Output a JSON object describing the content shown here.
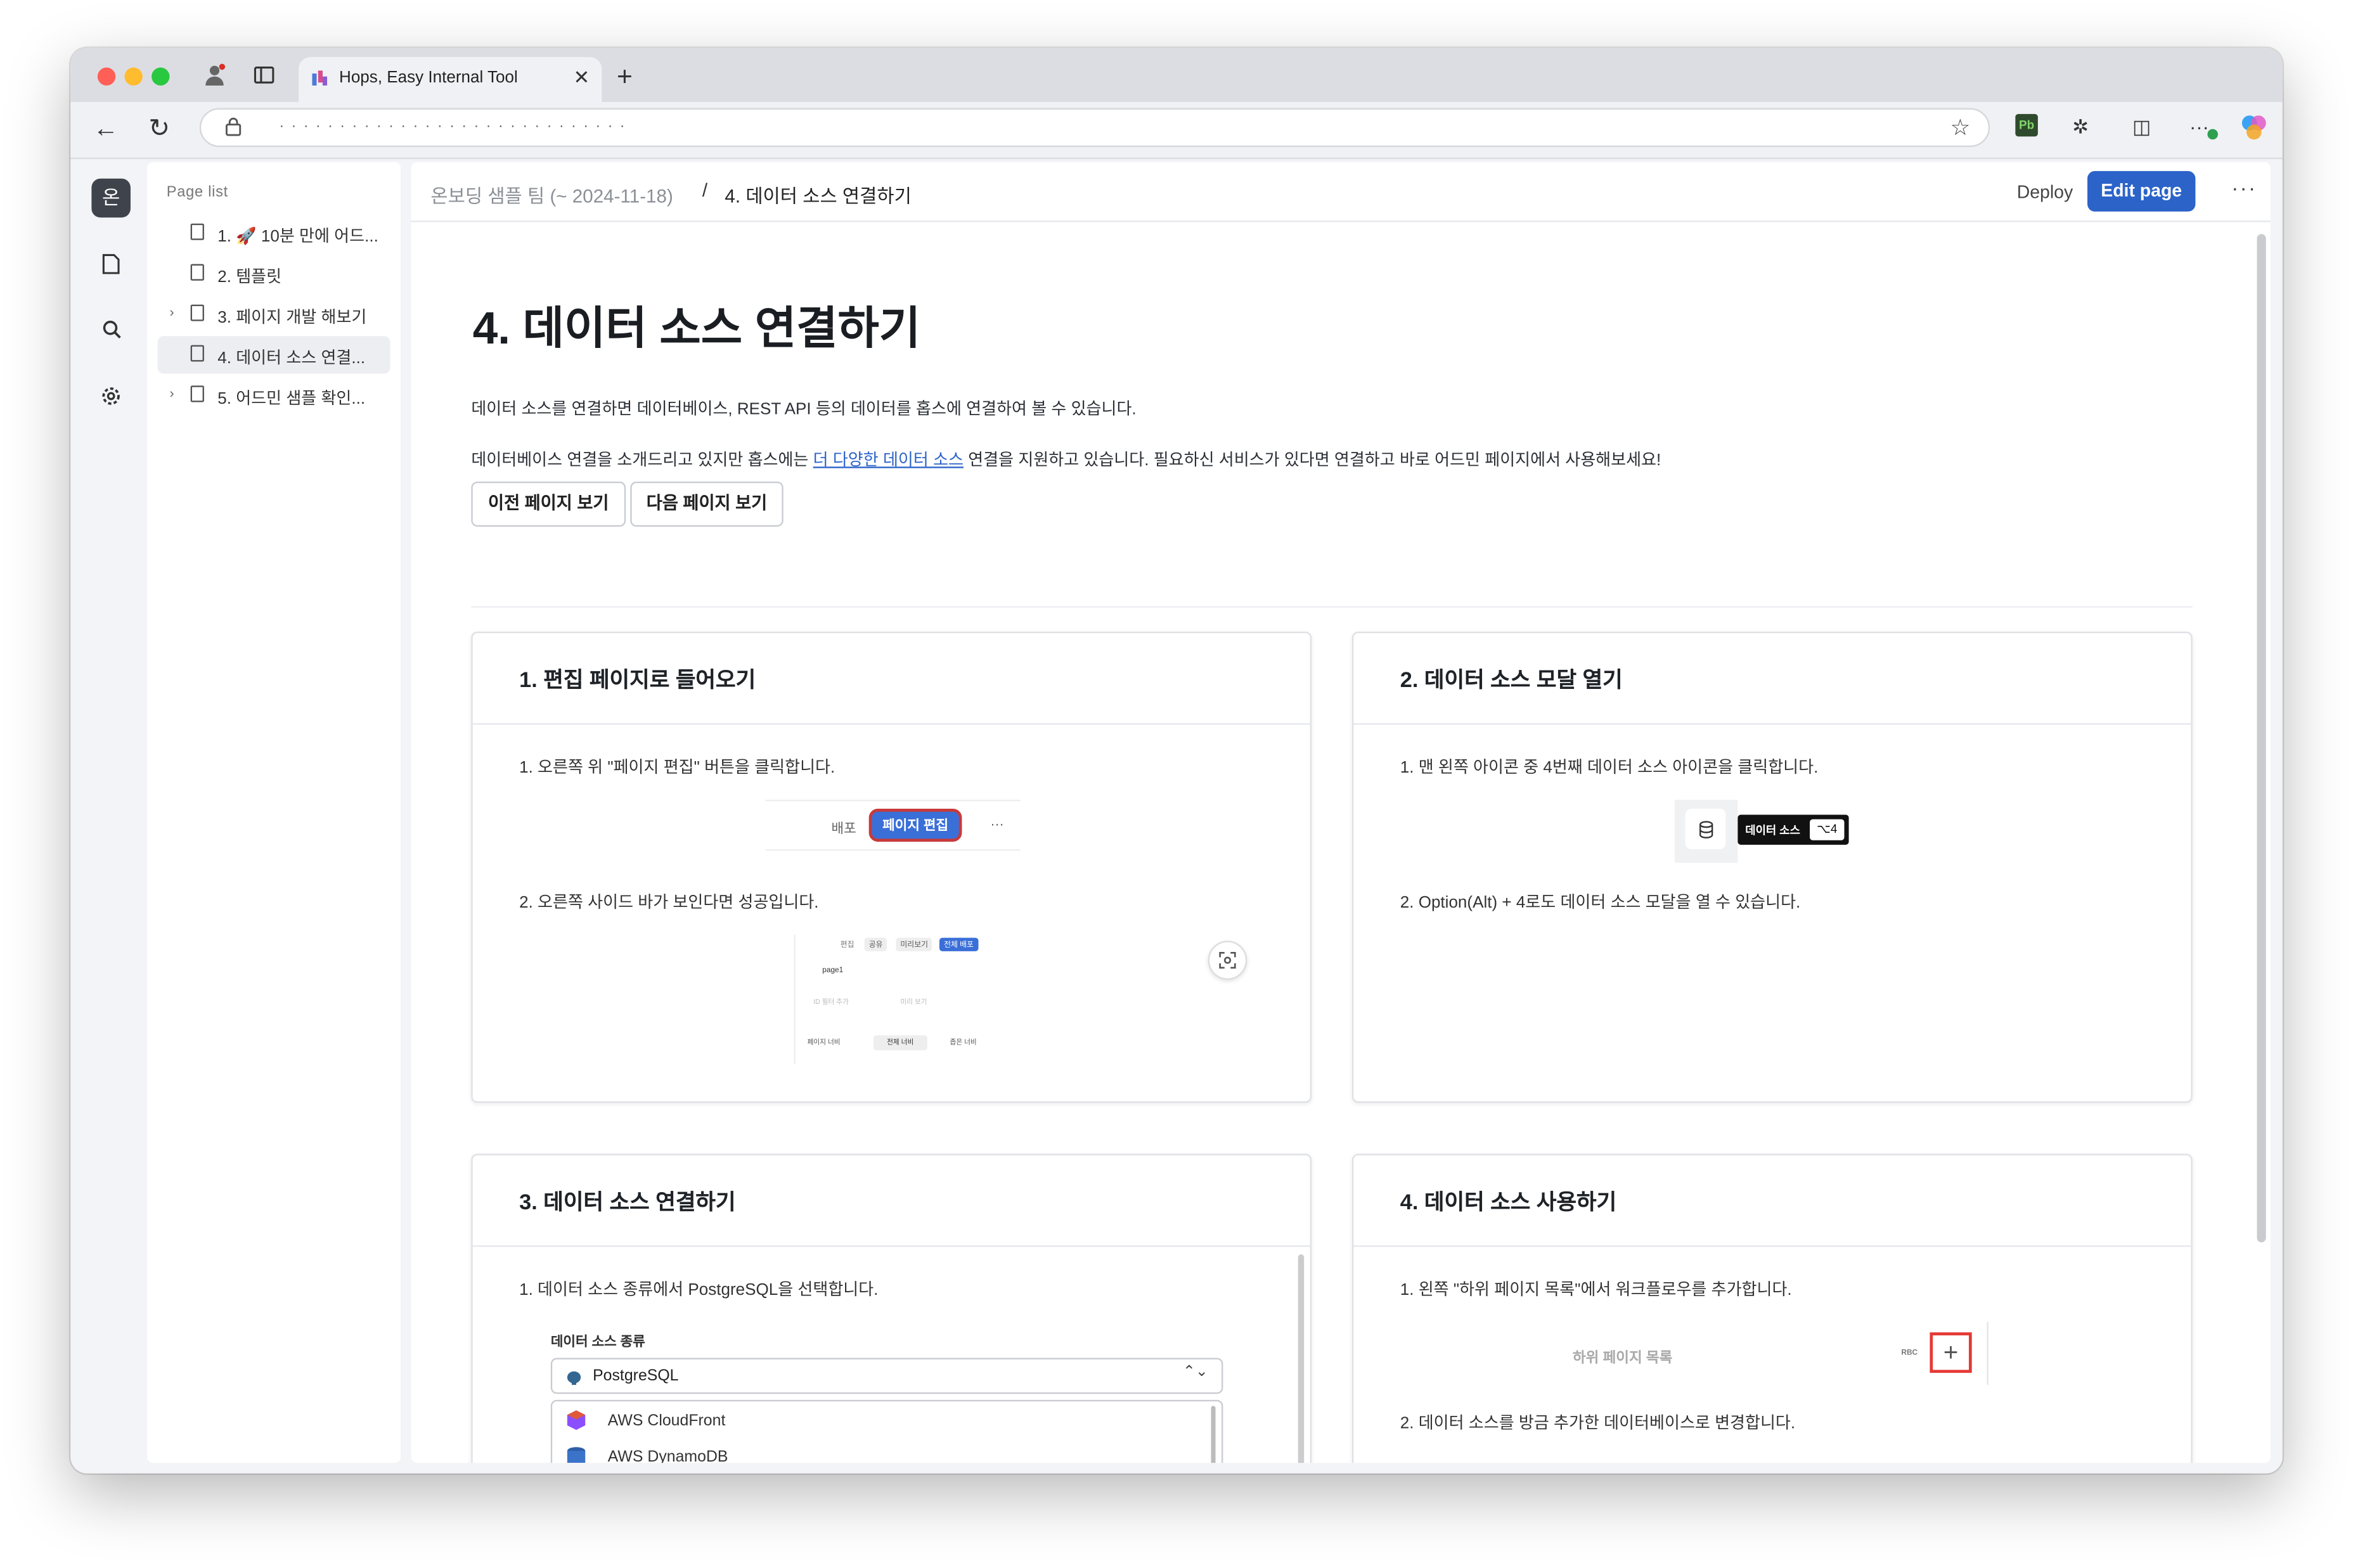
{
  "browser": {
    "tab_title": "Hops, Easy Internal Tool",
    "new_tab_label": "+",
    "url_text": "·  ·  ·  ·  ·  ·  ·  ·  ·  ·  ·  ·  ·  ·  ·  ·  ·  ·  ·  ·  ·  ·  ·  ·  ·  ·  ·  ·  ·",
    "extension_label": "Pb"
  },
  "rail": {
    "avatar_label": "온"
  },
  "page_list": {
    "title": "Page list",
    "items": [
      {
        "label": "1. 🚀 10분 만에 어드...",
        "has_children": false
      },
      {
        "label": "2. 템플릿",
        "has_children": false
      },
      {
        "label": "3. 페이지 개발 해보기",
        "has_children": true
      },
      {
        "label": "4. 데이터 소스 연결...",
        "has_children": false
      },
      {
        "label": "5. 어드민 샘플 확인...",
        "has_children": true
      }
    ]
  },
  "header": {
    "team": "온보딩 샘플 팀 (~ 2024-11-18)",
    "separator": "/",
    "page": "4. 데이터 소스 연결하기",
    "deploy_label": "Deploy",
    "edit_label": "Edit page",
    "more_label": "···"
  },
  "content": {
    "title": "4. 데이터 소스 연결하기",
    "para1": "데이터 소스를 연결하면 데이터베이스, REST API 등의 데이터를 홉스에 연결하여 볼 수 있습니다.",
    "para2_before": "데이터베이스 연결을 소개드리고 있지만 홉스에는 ",
    "para2_link": "더 다양한 데이터 소스",
    "para2_after": " 연결을 지원하고 있습니다. 필요하신 서비스가 있다면 연결하고 바로 어드민 페이지에서 사용해보세요!",
    "prev_button": "이전 페이지 보기",
    "next_button": "다음 페이지 보기"
  },
  "cards": [
    {
      "title": "1. 편집 페이지로 들어오기",
      "step1": "1. 오른쪽 위 \"페이지 편집\" 버튼을 클릭합니다.",
      "mock_deploy": "배포",
      "mock_edit": "페이지 편집",
      "mock_more": "···",
      "step2": "2. 오른쪽 사이드 바가 보인다면 성공입니다.",
      "mini_tabs": [
        "편집",
        "공유",
        "미리보기",
        "전체 배포"
      ],
      "mini_page": "page1",
      "mini_row": [
        "ID 필터 추가",
        "미리 보기"
      ],
      "mini_bottom": [
        "페이지 너비",
        "전체 너비",
        "좁은 너비"
      ]
    },
    {
      "title": "2.  데이터 소스 모달 열기",
      "step1": "1. 맨 왼쪽 아이콘 중 4번째 데이터 소스 아이콘을 클릭합니다.",
      "tooltip_label": "데이터 소스",
      "shortcut": "⌥4",
      "step2": "2.  Option(Alt) + 4로도 데이터 소스 모달을 열 수 있습니다."
    },
    {
      "title": "3. 데이터 소스 연결하기",
      "step1": "1.  데이터 소스 종류에서 PostgreSQL을 선택합니다.",
      "field_label": "데이터 소스 종류",
      "selected": "PostgreSQL",
      "options": [
        "AWS CloudFront",
        "AWS DynamoDB"
      ]
    },
    {
      "title": "4.  데이터 소스 사용하기",
      "step1": "1. 왼쪽 \"하위 페이지 목록\"에서 워크플로우를 추가합니다.",
      "mock_label": "하위 페이지 목록",
      "mock_tag": "RBC",
      "step2": "2. 데이터 소스를 방금 추가한 데이터베이스로 변경합니다."
    }
  ],
  "colors": {
    "accent": "#2b63c9",
    "highlight_box": "#e53935"
  }
}
